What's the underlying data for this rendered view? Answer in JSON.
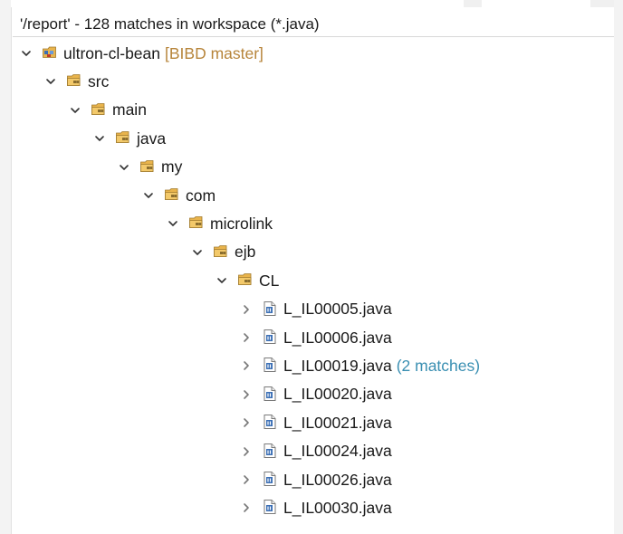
{
  "header": {
    "text": "'/report' - 128 matches in workspace (*.java)"
  },
  "colors": {
    "folder": "#e9b44c",
    "project_suffix": "#b7853b",
    "match_count": "#3a8fb2",
    "java_file": "#3b6fb5"
  },
  "tree": [
    {
      "label": "ultron-cl-bean",
      "suffix": "[BIBD master]",
      "icon": "project-icon",
      "expanded": true
    },
    {
      "label": "src",
      "icon": "package-folder-icon",
      "expanded": true
    },
    {
      "label": "main",
      "icon": "package-folder-icon",
      "expanded": true
    },
    {
      "label": "java",
      "icon": "package-folder-icon",
      "expanded": true
    },
    {
      "label": "my",
      "icon": "package-folder-icon",
      "expanded": true
    },
    {
      "label": "com",
      "icon": "package-folder-icon",
      "expanded": true
    },
    {
      "label": "microlink",
      "icon": "package-folder-icon",
      "expanded": true
    },
    {
      "label": "ejb",
      "icon": "package-folder-icon",
      "expanded": true
    },
    {
      "label": "CL",
      "icon": "package-folder-icon",
      "expanded": true
    },
    {
      "label": "L_IL00005.java",
      "icon": "java-file-icon",
      "expanded": false
    },
    {
      "label": "L_IL00006.java",
      "icon": "java-file-icon",
      "expanded": false
    },
    {
      "label": "L_IL00019.java",
      "matches": "(2 matches)",
      "icon": "java-file-icon",
      "expanded": false
    },
    {
      "label": "L_IL00020.java",
      "icon": "java-file-icon",
      "expanded": false
    },
    {
      "label": "L_IL00021.java",
      "icon": "java-file-icon",
      "expanded": false
    },
    {
      "label": "L_IL00024.java",
      "icon": "java-file-icon",
      "expanded": false
    },
    {
      "label": "L_IL00026.java",
      "icon": "java-file-icon",
      "expanded": false
    },
    {
      "label": "L_IL00030.java",
      "icon": "java-file-icon",
      "expanded": false
    }
  ]
}
